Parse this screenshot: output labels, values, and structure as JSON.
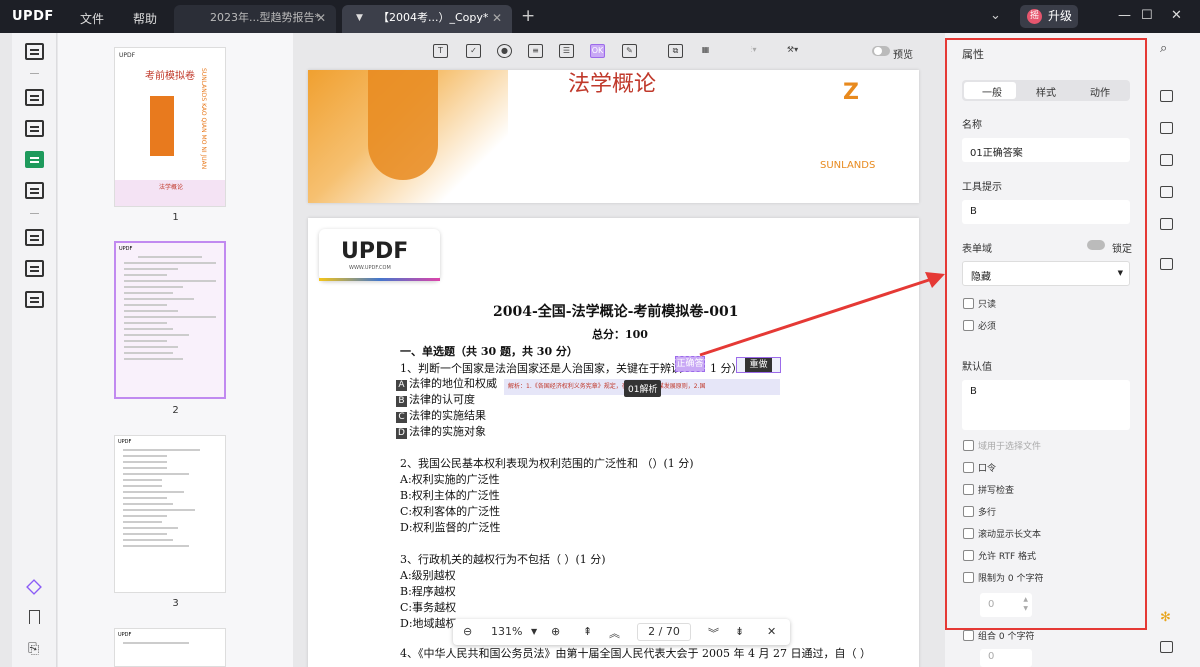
{
  "app": {
    "logo_u": "UPDF",
    "menu_file": "文件",
    "menu_help": "帮助",
    "upgrade": "升级",
    "upgrade_icon": "摇"
  },
  "tabs": [
    {
      "label": "2023年...型趋势报告*"
    },
    {
      "label": "【2004考...）_Copy*"
    }
  ],
  "thumbnails": [
    {
      "num": "1",
      "title": "考前模拟卷",
      "side": "SUNLANDS KAO QIAN MO NI JUAN",
      "band": "法学概论"
    },
    {
      "num": "2"
    },
    {
      "num": "3"
    }
  ],
  "toolbar": {
    "preview": "预览"
  },
  "doc": {
    "banner_title": "法学概论",
    "banner_brand": "SUNLANDS",
    "logo": "UPDF",
    "logo_url": "WWW.UPDF.COM",
    "title": "2004-全国-法学概论-考前模拟卷-001",
    "total": "总分：100",
    "section": "一、单选题（共 30 题，共 30 分）",
    "q1": "1、判断一个国家是法治国家还是人治国家，关键在于辨识",
    "q1_tail": "1 分）",
    "field_tag": "正确答",
    "field_name": "重做",
    "analysis": "解析：1.《各国经济权利义务宪章》规定，在国际合作以谋发展原则，2.国",
    "tooltip": "01解析",
    "q1_opts": [
      {
        "l": "A",
        "t": "法律的地位和权威"
      },
      {
        "l": "B",
        "t": "法律的认可度"
      },
      {
        "l": "C",
        "t": "法律的实施结果"
      },
      {
        "l": "D",
        "t": "法律的实施对象"
      }
    ],
    "q2": "2、我国公民基本权利表现为权利范围的广泛性和 （）(1 分)",
    "q2_opts": [
      "A:权利实施的广泛性",
      "B:权利主体的广泛性",
      "C:权利客体的广泛性",
      "D:权利监督的广泛性"
    ],
    "q3": "3、行政机关的越权行为不包括（ ）(1 分)",
    "q3_opts": [
      "A:级别越权",
      "B:程序越权",
      "C:事务越权",
      "D:地域越权"
    ],
    "q4": "4、《中华人民共和国公务员法》由第十届全国人民代表大会于 2005 年 4 月 27 日通过，自（ ）"
  },
  "zoombar": {
    "zoom": "131%",
    "page": "2",
    "sep": "/",
    "total": "70"
  },
  "props": {
    "heading": "属性",
    "tabs": [
      "一般",
      "样式",
      "动作"
    ],
    "name_label": "名称",
    "name_value": "01正确答案",
    "tooltip_label": "工具提示",
    "tooltip_value": "B",
    "form_field_label": "表单域",
    "lock_label": "锁定",
    "visibility": "隐藏",
    "readonly": "只读",
    "required": "必须",
    "default_label": "默认值",
    "default_value": "B",
    "checks": [
      "域用于选择文件",
      "口令",
      "拼写检查",
      "多行",
      "滚动显示长文本",
      "允许 RTF 格式",
      "限制为 0 个字符"
    ],
    "limit_value": "0",
    "comb": "组合 0 个字符",
    "comb_value": "0"
  }
}
